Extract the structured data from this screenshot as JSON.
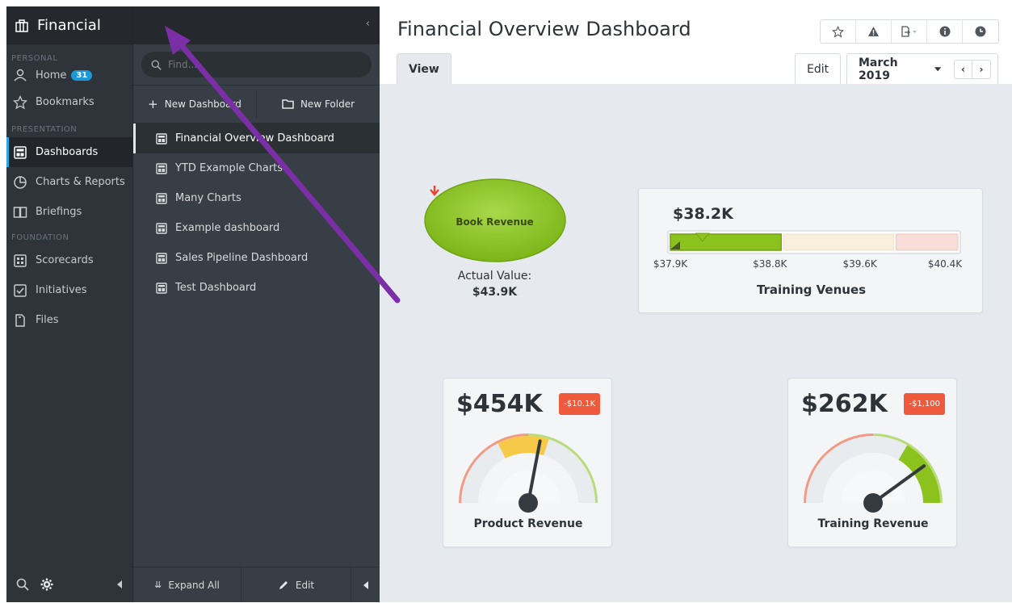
{
  "app": {
    "title": "Financial"
  },
  "nav": {
    "sections": [
      {
        "label": "PERSONAL"
      },
      {
        "label": "PRESENTATION"
      },
      {
        "label": "FOUNDATION"
      }
    ],
    "items": [
      {
        "label": "Home",
        "icon": "user-icon",
        "badge": "31"
      },
      {
        "label": "Bookmarks",
        "icon": "star-icon"
      },
      {
        "label": "Dashboards",
        "icon": "dashboard-icon",
        "active": true
      },
      {
        "label": "Charts & Reports",
        "icon": "pie-chart-icon"
      },
      {
        "label": "Briefings",
        "icon": "book-icon"
      },
      {
        "label": "Scorecards",
        "icon": "scorecard-icon"
      },
      {
        "label": "Initiatives",
        "icon": "checkbox-icon"
      },
      {
        "label": "Files",
        "icon": "file-icon"
      }
    ]
  },
  "panel": {
    "search_placeholder": "Find...",
    "search_value": "",
    "new_dashboard": "New Dashboard",
    "new_folder": "New Folder",
    "dashboards": [
      "Financial Overview Dashboard",
      "YTD Example Charts",
      "Many Charts",
      "Example dashboard",
      "Sales Pipeline Dashboard",
      "Test Dashboard"
    ],
    "expand_all": "Expand All",
    "edit": "Edit"
  },
  "main": {
    "title": "Financial Overview Dashboard",
    "tabs": {
      "view": "View",
      "edit": "Edit",
      "period": "March 2019"
    }
  },
  "widgets": {
    "book_revenue": {
      "label": "Book Revenue",
      "actual_label": "Actual Value:",
      "actual_value": "$43.9K",
      "trend": "down",
      "color": "#8cc21d"
    },
    "training_venues": {
      "title": "Training Venues",
      "value": "$38.2K"
    },
    "product_revenue": {
      "title": "Product Revenue",
      "value": "$454K",
      "delta": "-$10.1K"
    },
    "training_revenue": {
      "title": "Training Revenue",
      "value": "$262K",
      "delta": "-$1,100"
    }
  },
  "chart_data": [
    {
      "type": "bullet",
      "title": "Training Venues",
      "value": 38.2,
      "unit": "$K",
      "ticks": [
        "$37.9K",
        "$38.8K",
        "$39.6K",
        "$40.4K"
      ],
      "tick_values": [
        37.9,
        38.8,
        39.6,
        40.4
      ],
      "target": 38.2,
      "ranges": [
        {
          "from": 37.9,
          "to": 38.9,
          "color": "#e9f3d4"
        },
        {
          "from": 38.9,
          "to": 39.9,
          "color": "#f8efdc"
        },
        {
          "from": 39.9,
          "to": 40.9,
          "color": "#f7dcd8"
        }
      ],
      "bar": {
        "from": 37.9,
        "to": 38.9,
        "color": "#8cc21d"
      }
    },
    {
      "type": "gauge",
      "title": "Product Revenue",
      "value": "$454K",
      "needle_fraction": 0.56,
      "highlight_band": [
        0.35,
        0.6
      ],
      "highlight_color": "#f7c948"
    },
    {
      "type": "gauge",
      "title": "Training Revenue",
      "value": "$262K",
      "needle_fraction": 0.8,
      "highlight_band": [
        0.67,
        1.0
      ],
      "highlight_color": "#8cc21d"
    }
  ],
  "colors": {
    "nav_bg": "#2f343a",
    "panel_bg": "#383e45",
    "accent": "#2aa5e0",
    "badge": "#1c98d6",
    "alert": "#f05a3c",
    "annotation_arrow": "#7b2fa6"
  }
}
